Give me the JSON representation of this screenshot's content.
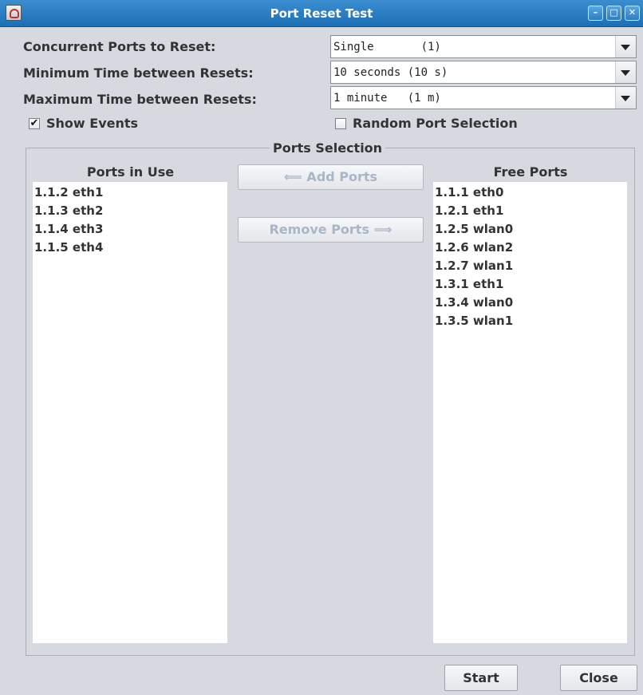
{
  "window": {
    "title": "Port Reset Test",
    "buttons": {
      "minimize": "–",
      "maximize": "□",
      "close": "✕"
    }
  },
  "settings": {
    "concurrent_label": "Concurrent Ports to Reset:",
    "concurrent_value": "Single       (1)",
    "min_time_label": "Minimum Time between Resets:",
    "min_time_value": "10 seconds (10 s)",
    "max_time_label": "Maximum Time between Resets:",
    "max_time_value": "1 minute   (1 m)"
  },
  "options": {
    "show_events_label": "Show Events",
    "show_events_checked": true,
    "random_port_label": "Random Port Selection",
    "random_port_checked": false,
    "checkmark": "✔"
  },
  "ports_selection": {
    "title": "Ports Selection",
    "in_use_header": "Ports in Use",
    "free_header": "Free Ports",
    "add_button": "⟸ Add Ports",
    "remove_button": "Remove Ports ⟹",
    "in_use": [
      "1.1.2 eth1",
      "1.1.3 eth2",
      "1.1.4 eth3",
      "1.1.5 eth4"
    ],
    "free": [
      "1.1.1 eth0",
      "1.2.1 eth1",
      "1.2.5 wlan0",
      "1.2.6 wlan2",
      "1.2.7 wlan1",
      "1.3.1 eth1",
      "1.3.4 wlan0",
      "1.3.5 wlan1"
    ]
  },
  "footer": {
    "start_button": "Start",
    "close_button": "Close"
  },
  "colors": {
    "titlebar": "#1d6fb5",
    "window_bg": "#d6d9df",
    "disabled_text": "#a8b6c8"
  }
}
